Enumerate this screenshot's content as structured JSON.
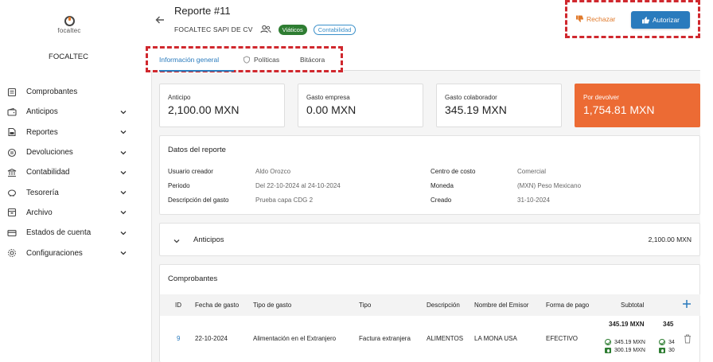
{
  "sidebar": {
    "logo_text": "focaltec",
    "company": "FOCALTEC",
    "items": [
      {
        "label": "Comprobantes",
        "icon": "receipt-icon",
        "has_chevron": false
      },
      {
        "label": "Anticipos",
        "icon": "wallet-icon",
        "has_chevron": true
      },
      {
        "label": "Reportes",
        "icon": "report-icon",
        "has_chevron": true
      },
      {
        "label": "Devoluciones",
        "icon": "refund-icon",
        "has_chevron": true
      },
      {
        "label": "Contabilidad",
        "icon": "bank-icon",
        "has_chevron": true
      },
      {
        "label": "Tesorería",
        "icon": "piggy-bank-icon",
        "has_chevron": true
      },
      {
        "label": "Archivo",
        "icon": "archive-icon",
        "has_chevron": true
      },
      {
        "label": "Estados de cuenta",
        "icon": "credit-card-icon",
        "has_chevron": true
      },
      {
        "label": "Configuraciones",
        "icon": "gear-icon",
        "has_chevron": true
      }
    ]
  },
  "header": {
    "title": "Reporte #11",
    "company": "FOCALTEC SAPI DE CV",
    "chip_viaticos": "Viáticos",
    "chip_contabilidad": "Contabilidad",
    "reject_label": "Rechazar",
    "authorize_label": "Autorizar"
  },
  "tabs": [
    {
      "label": "Información general",
      "active": true
    },
    {
      "label": "Políticas",
      "active": false
    },
    {
      "label": "Bitácora",
      "active": false
    }
  ],
  "summary": [
    {
      "label": "Anticipo",
      "value": "2,100.00 MXN"
    },
    {
      "label": "Gasto empresa",
      "value": "0.00 MXN"
    },
    {
      "label": "Gasto colaborador",
      "value": "345.19 MXN"
    },
    {
      "label": "Por devolver",
      "value": "1,754.81 MXN"
    }
  ],
  "datos": {
    "title": "Datos del reporte",
    "left": [
      {
        "k": "Usuario creador",
        "v": "Aldo Orozco"
      },
      {
        "k": "Periodo",
        "v": "Del 22-10-2024 al 24-10-2024"
      },
      {
        "k": "Descripción del gasto",
        "v": "Prueba capa CDG 2"
      }
    ],
    "right": [
      {
        "k": "Centro de costo",
        "v": "Comercial"
      },
      {
        "k": "Moneda",
        "v": "(MXN) Peso Mexicano"
      },
      {
        "k": "Creado",
        "v": "31-10-2024"
      }
    ]
  },
  "anticipos": {
    "label": "Anticipos",
    "total": "2,100.00 MXN"
  },
  "comprobantes": {
    "title": "Comprobantes",
    "headers": [
      "ID",
      "Fecha de gasto",
      "Tipo de gasto",
      "Tipo",
      "Descripción",
      "Nombre del Emisor",
      "Forma de pago",
      "Subtotal"
    ],
    "row": {
      "id": "9",
      "fecha": "22-10-2024",
      "tipo_gasto": "Alimentación en el Extranjero",
      "tipo": "Factura extranjera",
      "descripcion": "ALIMENTOS",
      "emisor": "LA MONA USA",
      "forma_pago": "EFECTIVO",
      "subtotal": "345.19 MXN",
      "subtotal_check": "345.19 MXN",
      "subtotal_cash": "300.19 MXN",
      "next_col_total": "345",
      "next_col_check": "34",
      "next_col_cash": "30"
    }
  },
  "colors": {
    "accent": "#2a7bbd",
    "orange": "#ec6b34",
    "green": "#2e7d32",
    "highlight": "#d0282e"
  }
}
